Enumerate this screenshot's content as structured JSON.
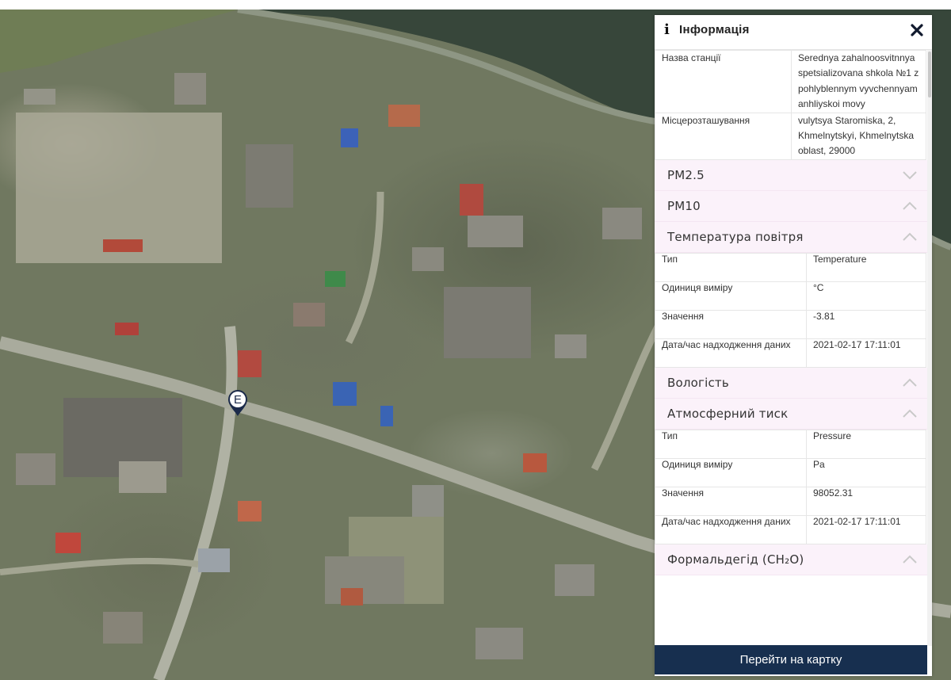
{
  "panel": {
    "title": "Інформація",
    "info_icon": "info-icon",
    "close_icon": "close-icon",
    "station_rows": [
      {
        "key": "Назва станції",
        "value": "Serednya zahalnoosvitnnya spetsializovana shkola №1 z pohlyblennym vyvchennyam anhliyskoi movy"
      },
      {
        "key": "Місцерозташування",
        "value": "vulytsya Staromiska, 2, Khmelnytskyi, Khmelnytska oblast, 29000"
      }
    ],
    "sections": {
      "pm25": {
        "label": "PM2.5",
        "state": "collapsed"
      },
      "pm10": {
        "label": "PM10",
        "state": "expanded"
      },
      "temperature": {
        "label": "Температура повітря",
        "state": "expanded",
        "rows": [
          {
            "key": "Тип",
            "value": "Temperature"
          },
          {
            "key": "Одиниця виміру",
            "value": "°C"
          },
          {
            "key": "Значення",
            "value": "-3.81"
          },
          {
            "key": "Дата/час надходження даних",
            "value": "2021-02-17 17:11:01"
          }
        ]
      },
      "humidity": {
        "label": "Вологість",
        "state": "expanded"
      },
      "pressure": {
        "label": "Атмосферний тиск",
        "state": "expanded",
        "rows": [
          {
            "key": "Тип",
            "value": "Pressure"
          },
          {
            "key": "Одиниця виміру",
            "value": "Pa"
          },
          {
            "key": "Значення",
            "value": "98052.31"
          },
          {
            "key": "Дата/час надходження даних",
            "value": "2021-02-17 17:11:01"
          }
        ]
      },
      "formaldehyde": {
        "label": "Формальдегід (CH₂O)",
        "state": "expanded"
      }
    },
    "go_to_map_label": "Перейти на картку"
  },
  "map": {
    "marker_letter": "E"
  },
  "colors": {
    "panel_header_bg": "#ffffff",
    "section_bg": "#fbf2fa",
    "button_bg": "#172f4f",
    "button_text": "#ffffff",
    "river": "#37463a"
  }
}
